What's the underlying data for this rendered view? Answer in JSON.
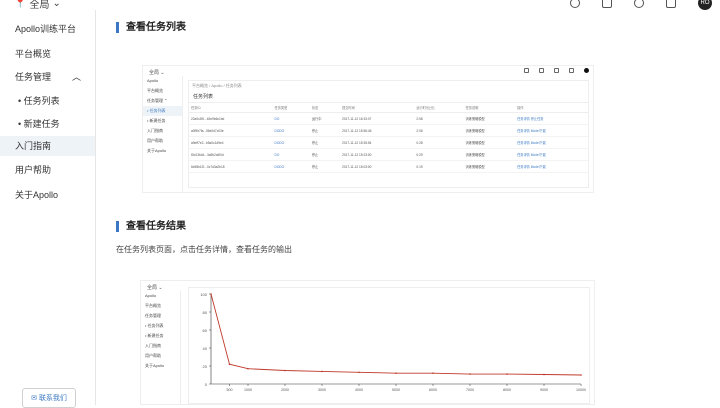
{
  "topbar": {
    "region": "全局",
    "avatar": "RO",
    "icons": [
      "search-icon",
      "document-icon",
      "message-icon",
      "export-icon"
    ]
  },
  "sidebar": {
    "title": "Apollo训练平台",
    "items": [
      {
        "label": "平台概览"
      },
      {
        "label": "任务管理"
      },
      {
        "label": "• 任务列表"
      },
      {
        "label": "• 新建任务"
      },
      {
        "label": "入门指南"
      },
      {
        "label": "用户帮助"
      },
      {
        "label": "关于Apollo"
      }
    ],
    "contact_label": "联系我们"
  },
  "main": {
    "section1_title": "查看任务列表",
    "section2_title": "查看任务结果",
    "section2_text": "在任务列表页面，点击任务详情，查看任务的输出"
  },
  "shot1": {
    "region": "全局 ⌄",
    "side": [
      "Apollo",
      "平台概览",
      "任务管理 ⌃",
      "• 任务列表",
      "• 新建任务",
      "入门指南",
      "用户帮助",
      "关于Apollo"
    ],
    "crumb": "平台概览 / Apollo / 任务列表",
    "card_title": "任务列表",
    "columns": [
      "任务ID",
      "任务类型",
      "状态",
      "提交时间",
      "运行时长(分)",
      "任务说明",
      "操作"
    ],
    "rows": [
      [
        "22a0c3f0...b3e9b6c1bd",
        "DO",
        "运行中",
        "2017-11-12 16:33:07",
        "2:58",
        "训练策略模型",
        "任务详情",
        "停止任务"
      ],
      [
        "a0f9b7fa...56e0d7c03e",
        "DODO",
        "停止",
        "2017-11-12 15:56:46",
        "2:06",
        "训练策略模型",
        "任务详情",
        "Model下载"
      ],
      [
        "a9eff7e2...b5a0c1d9e4",
        "DODO",
        "停止",
        "2017-11-12 15:35:54",
        "0:28",
        "训练策略模型",
        "任务详情",
        "Model下载"
      ],
      [
        "f0d13b4d...3a9b2c6f0d",
        "DO",
        "停止",
        "2017-11-12 15:23:00",
        "0:29",
        "训练策略模型",
        "任务详情",
        "Model下载"
      ],
      [
        "6e58b1f2...0c7d3a2b18",
        "DODO",
        "停止",
        "2017-11-12 15:03:00",
        "0:19",
        "训练策略模型",
        "任务详情",
        "Model下载"
      ]
    ]
  },
  "shot2": {
    "region": "全局 ⌄",
    "side": [
      "Apollo",
      "平台概览",
      "任务管理",
      "• 任务列表",
      "• 新建任务",
      "入门指南",
      "用户帮助",
      "关于Apollo"
    ]
  },
  "chart_data": {
    "type": "line",
    "title": "",
    "xlabel": "",
    "ylabel": "",
    "x": [
      0,
      500,
      1000,
      2000,
      3000,
      4000,
      5000,
      6000,
      7000,
      8000,
      9000,
      10000
    ],
    "series": [
      {
        "values": [
          100,
          22,
          17,
          15,
          14,
          13,
          12,
          12,
          11,
          11,
          10.5,
          10
        ]
      }
    ],
    "xlim": [
      0,
      10000
    ],
    "ylim": [
      0,
      100
    ],
    "y_ticks": [
      0,
      20,
      40,
      60,
      80,
      100
    ],
    "grid": false,
    "colors": {
      "line": "#c0392b",
      "axis": "#333333"
    }
  }
}
